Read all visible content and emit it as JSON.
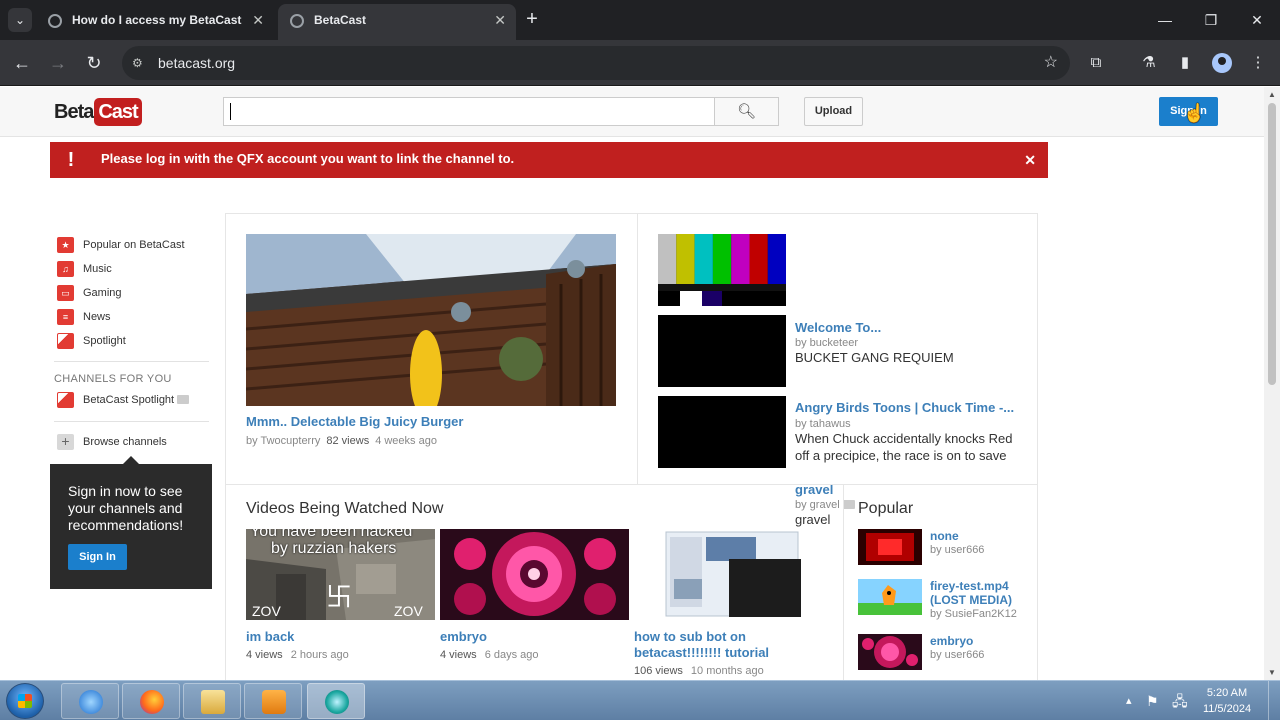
{
  "browser": {
    "tabs": [
      {
        "title": "How do I access my BetaCast c",
        "active": false
      },
      {
        "title": "BetaCast",
        "active": true
      }
    ],
    "url": "betacast.org"
  },
  "site": {
    "logo_beta": "Beta",
    "logo_cast": "Cast",
    "search": {
      "value": "",
      "placeholder": ""
    },
    "upload_label": "Upload",
    "signin_label": "Sign In",
    "alert_text": "Please log in with the QFX account you want to link the channel to."
  },
  "sidebar": {
    "items": [
      {
        "label": "Popular on BetaCast",
        "icon": "star-icon"
      },
      {
        "label": "Music",
        "icon": "headphones-icon"
      },
      {
        "label": "Gaming",
        "icon": "gamepad-icon"
      },
      {
        "label": "News",
        "icon": "newspaper-icon"
      },
      {
        "label": "Spotlight",
        "icon": "spotlight-icon"
      }
    ],
    "channels_heading": "CHANNELS FOR YOU",
    "channel_item": "BetaCast Spotlight",
    "browse_label": "Browse channels",
    "promo_text": "Sign in now to see your channels and recommendations!",
    "promo_button": "Sign In"
  },
  "featured": {
    "title": "Mmm.. Delectable Big Juicy Burger",
    "author": "by Twocupterry",
    "views": "82 views",
    "age": "4 weeks ago"
  },
  "side_videos": [
    {
      "title": "Welcome To...",
      "author": "by bucketeer",
      "desc": "BUCKET GANG REQUIEM"
    },
    {
      "title": "Angry Birds Toons | Chuck Time -...",
      "author": "by tahawus",
      "desc": "When Chuck accidentally knocks Red off a precipice, the race is on to save"
    },
    {
      "title": "gravel",
      "author": "by gravel",
      "desc": "gravel"
    }
  ],
  "watched_now": {
    "heading": "Videos Being Watched Now",
    "videos": [
      {
        "title": "im back",
        "views": "4 views",
        "age": "2 hours ago",
        "overlay1": "You have been hacked",
        "overlay2": "by ruzzian hakers",
        "overlay3": "ZOV",
        "overlay4": "卐",
        "overlay5": "ZOV"
      },
      {
        "title": "embryo",
        "views": "4 views",
        "age": "6 days ago"
      },
      {
        "title": "how to sub bot on betacast!!!!!!!! tutorial",
        "views": "106 views",
        "age": "10 months ago"
      }
    ]
  },
  "popular": {
    "heading": "Popular",
    "items": [
      {
        "title": "none",
        "author": "by user666"
      },
      {
        "title": "firey-test.mp4 (LOST MEDIA)",
        "author": "by SusieFan2K12"
      },
      {
        "title": "embryo",
        "author": "by user666"
      }
    ]
  },
  "taskbar": {
    "time": "5:20 AM",
    "date": "11/5/2024"
  }
}
